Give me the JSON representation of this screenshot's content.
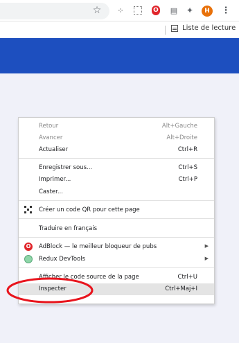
{
  "browser": {
    "avatar_initial": "H",
    "adblock_glyph": "O",
    "reading_list_label": "Liste de lecture",
    "menu_glyph": "⋮",
    "star_glyph": "☆",
    "puzzle_glyph": "✦"
  },
  "colors": {
    "page_header": "#1d4fbf",
    "page_background": "#f0f1f9",
    "annotation": "#e8141d",
    "avatar": "#e8710a"
  },
  "context_menu": {
    "items": [
      {
        "label": "Retour",
        "shortcut": "Alt+Gauche",
        "disabled": true
      },
      {
        "label": "Avancer",
        "shortcut": "Alt+Droite",
        "disabled": true
      },
      {
        "label": "Actualiser",
        "shortcut": "Ctrl+R"
      },
      {
        "label": "Enregistrer sous...",
        "shortcut": "Ctrl+S"
      },
      {
        "label": "Imprimer...",
        "shortcut": "Ctrl+P"
      },
      {
        "label": "Caster..."
      },
      {
        "label": "Créer un code QR pour cette page",
        "icon": "qr-code-icon"
      },
      {
        "label": "Traduire en français"
      },
      {
        "label": "AdBlock — le meilleur bloqueur de pubs",
        "icon": "adblock-icon",
        "submenu": true
      },
      {
        "label": "Redux DevTools",
        "icon": "redux-devtools-icon",
        "submenu": true
      },
      {
        "label": "Afficher le code source de la page",
        "shortcut": "Ctrl+U"
      },
      {
        "label": "Inspecter",
        "shortcut": "Ctrl+Maj+I",
        "highlighted": true
      }
    ]
  }
}
